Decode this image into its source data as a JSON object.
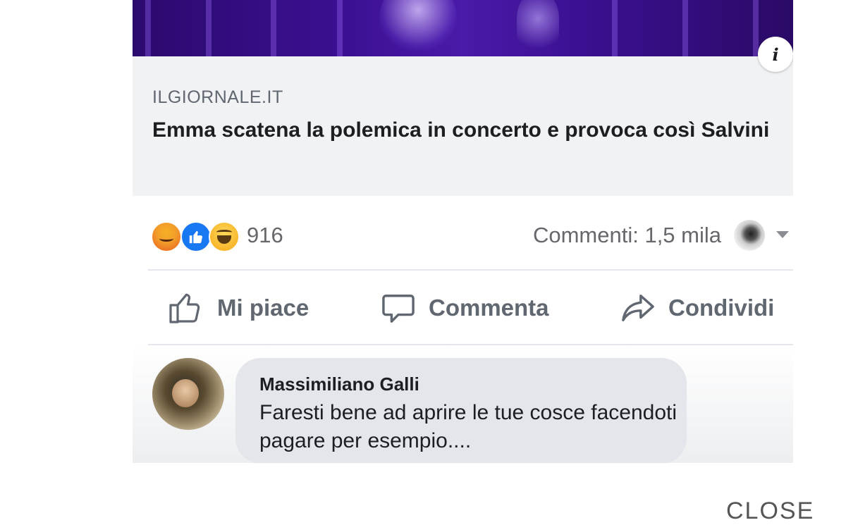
{
  "link_preview": {
    "domain": "ILGIORNALE.IT",
    "headline": "Emma scatena la polemica in concerto e provoca così Salvini",
    "info_icon": "i"
  },
  "reactions": {
    "icons": [
      "angry-reaction-icon",
      "like-reaction-icon",
      "haha-reaction-icon"
    ],
    "count": "916",
    "comments_label": "Commenti: 1,5 mila"
  },
  "actions": {
    "like_label": "Mi piace",
    "comment_label": "Commenta",
    "share_label": "Condividi"
  },
  "comment": {
    "author": "Massimiliano Galli",
    "text": "Faresti bene ad aprire le tue cosce facendoti pagare per esempio...."
  },
  "footer": {
    "close_label": "CLOSE"
  },
  "colors": {
    "like_blue": "#1877f2",
    "hero_purple": "#3a0f8f",
    "preview_bg": "#f1f2f4",
    "text_gray": "#606770"
  }
}
